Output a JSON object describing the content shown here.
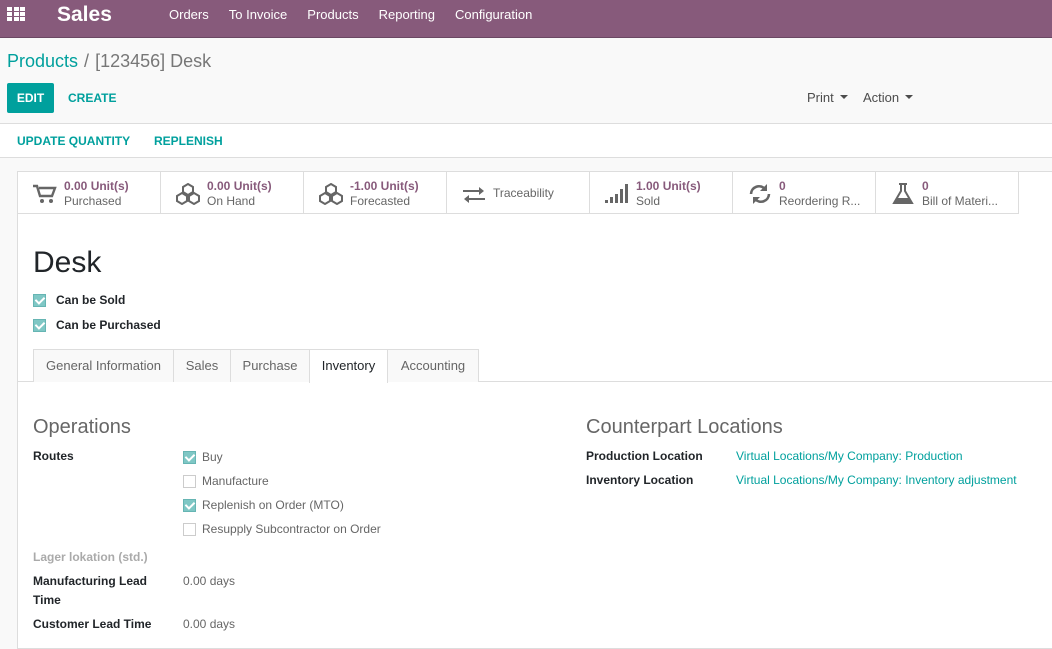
{
  "navbar": {
    "app_name": "Sales",
    "menu": [
      "Orders",
      "To Invoice",
      "Products",
      "Reporting",
      "Configuration"
    ]
  },
  "breadcrumb": {
    "parent": "Products",
    "separator": "/",
    "current": "[123456] Desk"
  },
  "toolbar": {
    "edit": "EDIT",
    "create": "CREATE",
    "print": "Print",
    "action": "Action"
  },
  "statusbar": {
    "update_quantity": "UPDATE QUANTITY",
    "replenish": "REPLENISH"
  },
  "smart_buttons": [
    {
      "icon": "cart-icon",
      "value": "0.00 Unit(s)",
      "label": "Purchased"
    },
    {
      "icon": "cubes-icon",
      "value": "0.00 Unit(s)",
      "label": "On Hand"
    },
    {
      "icon": "cubes-icon",
      "value": "-1.00 Unit(s)",
      "label": "Forecasted"
    },
    {
      "icon": "exchange-arrows-icon",
      "value": "",
      "label": "Traceability"
    },
    {
      "icon": "signal-bars-icon",
      "value": "1.00 Unit(s)",
      "label": "Sold"
    },
    {
      "icon": "refresh-icon",
      "value": "0",
      "label": "Reordering R..."
    },
    {
      "icon": "flask-icon",
      "value": "0",
      "label": "Bill of Materi..."
    }
  ],
  "product": {
    "name": "Desk",
    "can_be_sold": "Can be Sold",
    "can_be_purchased": "Can be Purchased"
  },
  "tabs": [
    "General Information",
    "Sales",
    "Purchase",
    "Inventory",
    "Accounting"
  ],
  "active_tab": "Inventory",
  "operations": {
    "title": "Operations",
    "routes_label": "Routes",
    "routes": [
      {
        "label": "Buy",
        "checked": true
      },
      {
        "label": "Manufacture",
        "checked": false
      },
      {
        "label": "Replenish on Order (MTO)",
        "checked": true
      },
      {
        "label": "Resupply Subcontractor on Order",
        "checked": false
      }
    ],
    "lager_label": "Lager lokation (std.)",
    "manufacturing_lead_label_1": "Manufacturing Lead",
    "manufacturing_lead_label_2": "Time",
    "manufacturing_lead_value": "0.00 days",
    "customer_lead_label": "Customer Lead Time",
    "customer_lead_value": "0.00 days"
  },
  "counterpart": {
    "title": "Counterpart Locations",
    "production_label": "Production Location",
    "production_value": "Virtual Locations/My Company: Production",
    "inventory_label": "Inventory Location",
    "inventory_value": "Virtual Locations/My Company: Inventory adjustment"
  },
  "colors": {
    "brand": "#875a7b",
    "accent": "#00a09d"
  }
}
